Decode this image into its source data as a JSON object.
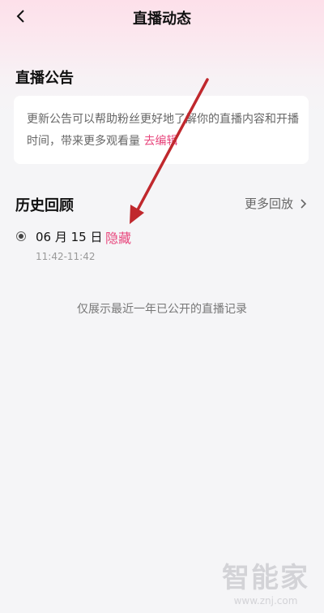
{
  "nav": {
    "title": "直播动态",
    "back_icon": "chevron-left-icon"
  },
  "notice": {
    "heading": "直播公告",
    "text": "更新公告可以帮助粉丝更好地了解你的直播内容和开播时间，带来更多观看量 ",
    "edit_link": "去编辑"
  },
  "history": {
    "heading": "历史回顾",
    "more": "更多回放",
    "more_icon": "chevron-right-icon",
    "items": [
      {
        "date": "06 月 15 日",
        "action": "隐藏",
        "time": "11:42-11:42"
      }
    ],
    "footnote": "仅展示最近一年已公开的直播记录"
  },
  "watermark": {
    "main": "智能家",
    "sub": "www.znj.com"
  },
  "colors": {
    "accent": "#e8477d",
    "annotation_arrow": "#c0282d"
  }
}
